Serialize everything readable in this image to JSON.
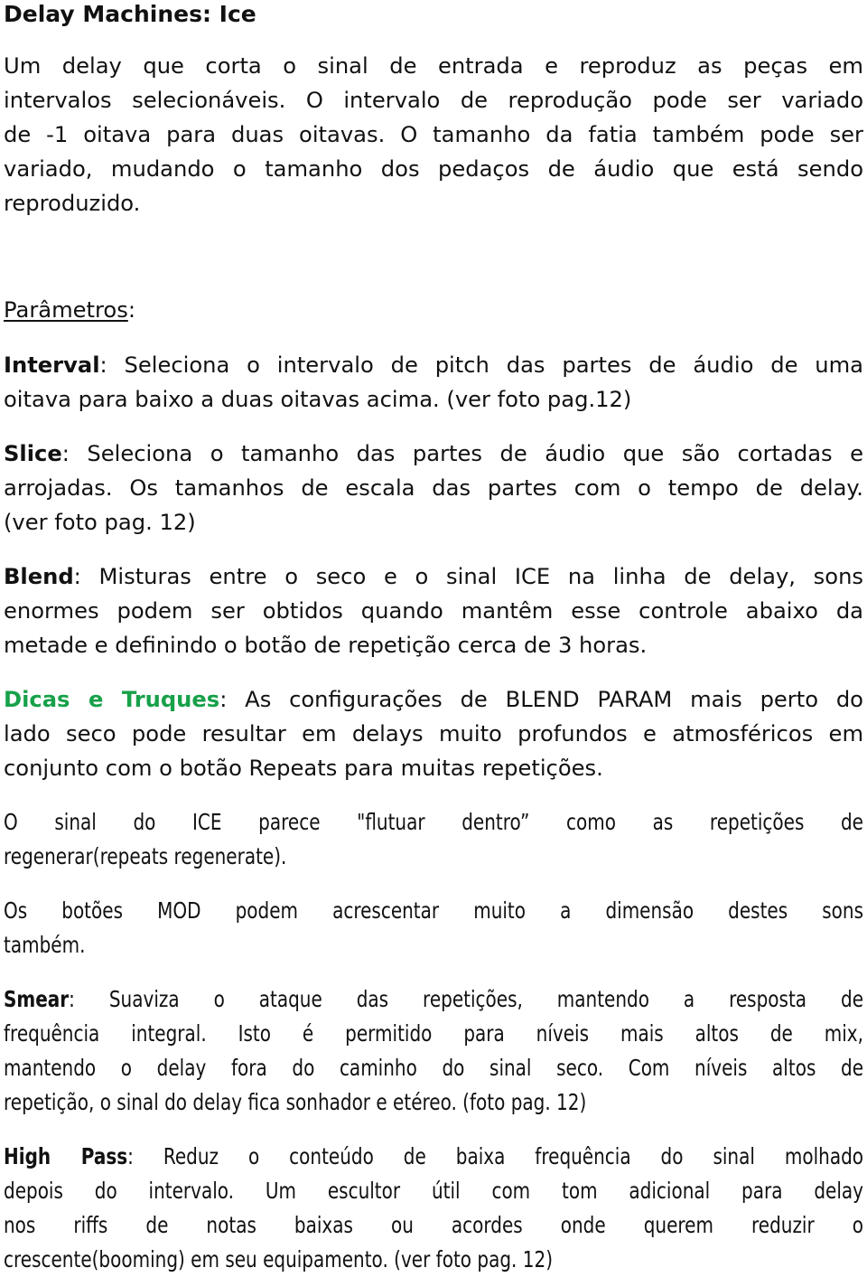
{
  "document": {
    "title": "Delay Machines: Ice",
    "intro": {
      "lines": [
        "Um delay que corta o sinal de entrada e reproduz as peças em",
        "intervalos selecionáveis. O intervalo de reprodução pode ser variado",
        "de -1 oitava para duas oitavas. O tamanho da fatia também pode ser",
        "variado, mudando o tamanho dos pedaços de áudio que está sendo",
        "reproduzido."
      ]
    },
    "parameters_heading": "Parâmetros",
    "parameters_colon": ":",
    "params": [
      {
        "name": "Interval",
        "lines": [
          ": Seleciona o intervalo de pitch das partes de áudio de uma",
          "oitava para baixo a duas oitavas acima. (ver foto pag.12)"
        ]
      },
      {
        "name": "Slice",
        "lines": [
          ": Seleciona o tamanho das partes de áudio que são cortadas e",
          "arrojadas. Os tamanhos de escala das partes com o tempo de delay.",
          "(ver foto pag. 12)"
        ]
      },
      {
        "name": "Blend",
        "lines": [
          ": Misturas entre o seco e o sinal ICE na linha de delay, sons",
          "enormes podem ser obtidos quando mantêm esse controle abaixo da",
          "metade e definindo o botão de repetição cerca de 3 horas."
        ]
      }
    ],
    "tips": {
      "heading": "Dicas e Truques",
      "lines": [
        ": As configurações de BLEND PARAM mais perto do",
        "lado seco pode resultar em delays muito profundos e atmosféricos em",
        "conjunto com o botão Repeats para muitas repetições."
      ]
    },
    "ice_float": {
      "lines": [
        "O sinal do ICE parece \"flutuar dentro” como as repetições de",
        "regenerar(repeats regenerate)."
      ]
    },
    "mod": {
      "lines": [
        "Os botões MOD podem acrescentar muito a dimensão destes sons",
        "também."
      ]
    },
    "smear": {
      "name": "Smear",
      "lines": [
        ": Suaviza o ataque das repetições, mantendo a resposta de",
        "frequência integral. Isto é permitido para níveis mais altos de mix,",
        "mantendo o delay fora do caminho do sinal seco. Com níveis altos de",
        "repetição, o sinal do delay fica sonhador e etéreo. (foto pag. 12)"
      ]
    },
    "high_pass": {
      "name": "High Pass",
      "lines": [
        ": Reduz o conteúdo de baixa frequência do sinal molhado",
        "depois do intervalo. Um escultor útil com tom adicional para delay",
        "nos riffs de notas baixas ou acordes onde querem reduzir o",
        "crescente(booming) em seu equipamento. (ver foto pag. 12)"
      ]
    },
    "colors": {
      "text": "#111111",
      "tips_heading": "#17a14a"
    }
  }
}
